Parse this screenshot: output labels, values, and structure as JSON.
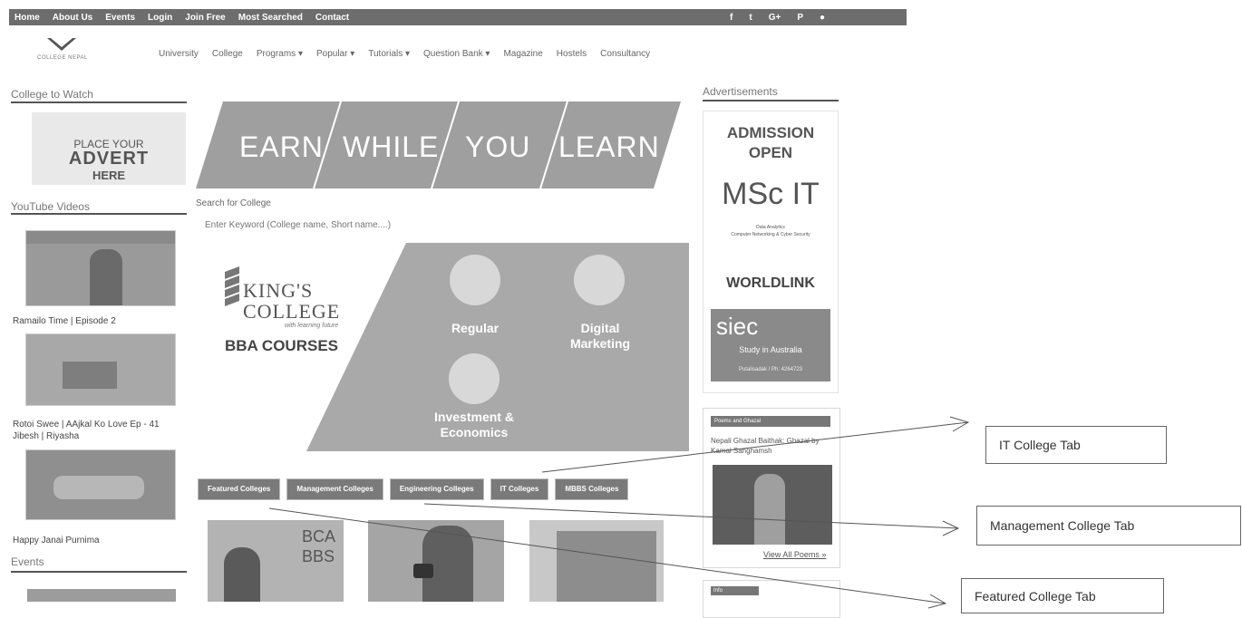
{
  "topbar": {
    "links": [
      "Home",
      "About Us",
      "Events",
      "Login",
      "Join Free",
      "Most Searched",
      "Contact"
    ],
    "social_icons": [
      "facebook-icon",
      "twitter-icon",
      "google-plus-icon",
      "pinterest-icon",
      "user-icon"
    ]
  },
  "logo": {
    "text": "COLLEGE NEPAL"
  },
  "mainnav": [
    "University",
    "College",
    "Programs ▾",
    "Popular ▾",
    "Tutorials ▾",
    "Question Bank ▾",
    "Magazine",
    "Hostels",
    "Consultancy"
  ],
  "left": {
    "college_to_watch": "College to Watch",
    "advert": {
      "line1": "PLACE YOUR",
      "line2": "ADVERT",
      "line3": "HERE"
    },
    "youtube_title": "YouTube Videos",
    "videos": [
      {
        "title": "Ramailo Time | Episode 2"
      },
      {
        "title": "Rotoi Swee | AAjkal Ko Love Ep - 41 Jibesh | Riyasha"
      },
      {
        "title": "Happy Janai Purnima"
      }
    ],
    "events_title": "Events"
  },
  "banner": {
    "words": [
      "EARN",
      "WHILE",
      "YOU",
      "LEARN"
    ]
  },
  "search": {
    "label": "Search for College",
    "placeholder": "Enter Keyword (College name, Short name....)"
  },
  "kings_ad": {
    "logo_line1": "KING'S",
    "logo_line2": "COLLEGE",
    "tagline": "with learning future",
    "courses": "BBA COURSES",
    "offers": [
      "Regular",
      "Digital Marketing",
      "Investment & Economics"
    ]
  },
  "tabs": [
    "Featured Colleges",
    "Management Colleges",
    "Engineering Colleges",
    "IT Colleges",
    "MBBS Colleges"
  ],
  "featured": {
    "thumb1_text1": "BCA",
    "thumb1_text2": "BBS"
  },
  "right": {
    "ads_title": "Advertisements",
    "admission": {
      "line1": "ADMISSION",
      "line2": "OPEN",
      "line3": "MSc IT",
      "line4": "Data Analytics",
      "line5": "Computer Networking & Cyber Security"
    },
    "worldlink": "WORLDLINK",
    "siec": {
      "name": "siec",
      "sub": "Study in Australia",
      "contact": "Putalisadak / Ph: 4264723"
    },
    "poems": {
      "title": "Poems and Ghazal",
      "item": "Nepali Ghazal Baithak: Ghazal by Kamal Sanghamsh",
      "view_all": "View All Poems »"
    },
    "news": {
      "title": "Info"
    }
  },
  "callouts": {
    "it": "IT College Tab",
    "management": "Management College Tab",
    "featured": "Featured College Tab"
  }
}
